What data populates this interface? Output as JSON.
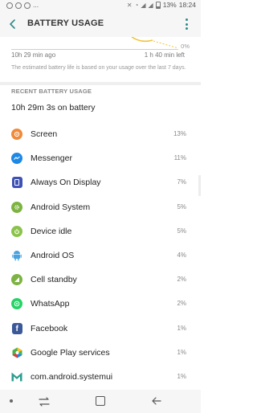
{
  "status_bar": {
    "battery": "13%",
    "time": "18:24",
    "overflow": "..."
  },
  "app_bar": {
    "title": "BATTERY USAGE"
  },
  "graph": {
    "zero_label": "0%",
    "time_left": "10h 29 min ago",
    "time_right": "1 h 40 min left"
  },
  "note": "The estimated battery life is based on your usage over the last 7 days.",
  "section_header": "RECENT BATTERY USAGE",
  "total": "10h 29m 3s on battery",
  "apps": [
    {
      "name": "Screen",
      "percent": "13%",
      "icon": "screen-icon",
      "color": "#f08a3a"
    },
    {
      "name": "Messenger",
      "percent": "11%",
      "icon": "messenger-icon",
      "color": "#1e88e5"
    },
    {
      "name": "Always On Display",
      "percent": "7%",
      "icon": "always-on-display-icon",
      "color": "#3f51b5"
    },
    {
      "name": "Android System",
      "percent": "5%",
      "icon": "android-system-icon",
      "color": "#7cb342"
    },
    {
      "name": "Device idle",
      "percent": "5%",
      "icon": "device-idle-icon",
      "color": "#8bc34a"
    },
    {
      "name": "Android OS",
      "percent": "4%",
      "icon": "android-os-icon",
      "color": "#4aa3df"
    },
    {
      "name": "Cell standby",
      "percent": "2%",
      "icon": "cell-standby-icon",
      "color": "#7cb342"
    },
    {
      "name": "WhatsApp",
      "percent": "2%",
      "icon": "whatsapp-icon",
      "color": "#25d366"
    },
    {
      "name": "Facebook",
      "percent": "1%",
      "icon": "facebook-icon",
      "color": "#3b5998"
    },
    {
      "name": "Google Play services",
      "percent": "1%",
      "icon": "google-play-services-icon",
      "color": "#4caf50"
    },
    {
      "name": "com.android.systemui",
      "percent": "1%",
      "icon": "systemui-icon",
      "color": "#2a9d8f"
    }
  ]
}
